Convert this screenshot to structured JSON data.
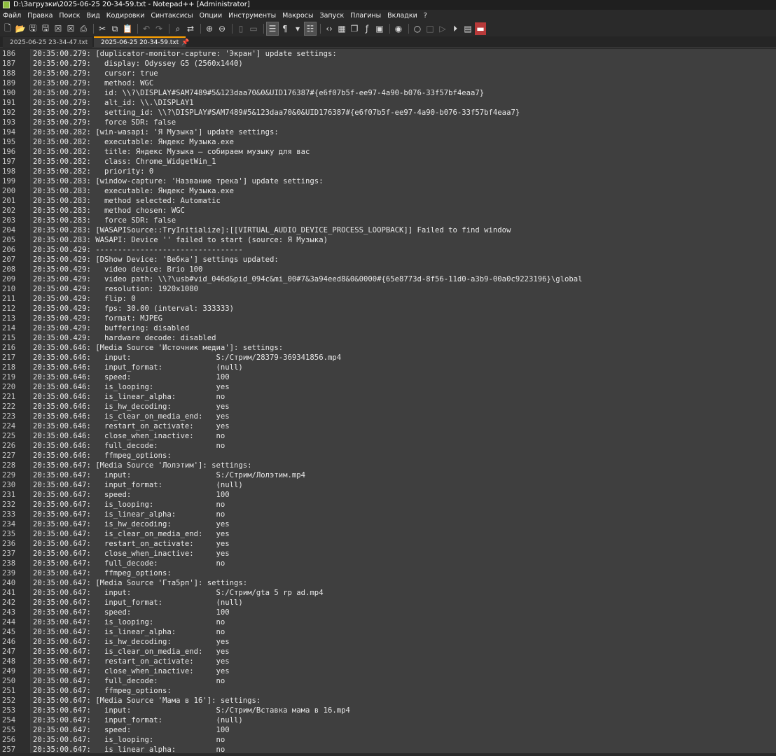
{
  "window": {
    "title": "D:\\Загрузки\\2025-06-25 20-34-59.txt - Notepad++ [Administrator]"
  },
  "menu": [
    "Файл",
    "Правка",
    "Поиск",
    "Вид",
    "Кодировки",
    "Синтаксисы",
    "Опции",
    "Инструменты",
    "Макросы",
    "Запуск",
    "Плагины",
    "Вкладки",
    "?"
  ],
  "toolbar": {
    "icons": [
      {
        "name": "new-file-icon",
        "glyph": "🗋"
      },
      {
        "name": "open-file-icon",
        "glyph": "📂"
      },
      {
        "name": "save-icon",
        "glyph": "🖫"
      },
      {
        "name": "save-all-icon",
        "glyph": "🖫"
      },
      {
        "name": "close-icon",
        "glyph": "☒"
      },
      {
        "name": "close-all-icon",
        "glyph": "☒"
      },
      {
        "name": "print-icon",
        "glyph": "⎙"
      },
      {
        "sep": true
      },
      {
        "name": "cut-icon",
        "glyph": "✂"
      },
      {
        "name": "copy-icon",
        "glyph": "⧉"
      },
      {
        "name": "paste-icon",
        "glyph": "📋"
      },
      {
        "sep": true
      },
      {
        "name": "undo-icon",
        "glyph": "↶",
        "dim": true
      },
      {
        "name": "redo-icon",
        "glyph": "↷",
        "dim": true
      },
      {
        "sep": true
      },
      {
        "name": "find-icon",
        "glyph": "⌕"
      },
      {
        "name": "replace-icon",
        "glyph": "⇄"
      },
      {
        "sep": true
      },
      {
        "name": "zoom-in-icon",
        "glyph": "⊕"
      },
      {
        "name": "zoom-out-icon",
        "glyph": "⊖"
      },
      {
        "sep": true
      },
      {
        "name": "sync-vertical-icon",
        "glyph": "▯",
        "dim": true
      },
      {
        "name": "sync-horizontal-icon",
        "glyph": "▭",
        "dim": true
      },
      {
        "sep": true
      },
      {
        "name": "word-wrap-icon",
        "glyph": "☰",
        "sel": true
      },
      {
        "name": "show-all-chars-icon",
        "glyph": "¶"
      },
      {
        "name": "dropdown-arrow-icon",
        "glyph": "▾"
      },
      {
        "name": "indent-guide-icon",
        "glyph": "☷",
        "sel": true
      },
      {
        "sep": true
      },
      {
        "name": "language-icon",
        "glyph": "‹›"
      },
      {
        "name": "document-map-icon",
        "glyph": "▦"
      },
      {
        "name": "document-list-icon",
        "glyph": "❐"
      },
      {
        "name": "function-list-icon",
        "glyph": "ƒ"
      },
      {
        "name": "folder-workspace-icon",
        "glyph": "▣"
      },
      {
        "sep": true
      },
      {
        "name": "monitoring-icon",
        "glyph": "◉"
      },
      {
        "sep": true
      },
      {
        "name": "record-macro-icon",
        "glyph": "○"
      },
      {
        "name": "stop-macro-icon",
        "glyph": "□",
        "dim": true
      },
      {
        "name": "play-macro-icon",
        "glyph": "▷",
        "dim": true
      },
      {
        "name": "run-macro-multiple-icon",
        "glyph": "⏵"
      },
      {
        "name": "save-macro-icon",
        "glyph": "▤"
      },
      {
        "name": "spell-check-icon",
        "glyph": "▬",
        "danger": true
      }
    ]
  },
  "tabs": [
    {
      "label": "2025-06-25 23-34-47.txt",
      "active": false
    },
    {
      "label": "2025-06-25 20-34-59.txt",
      "active": true
    }
  ],
  "editor": {
    "lines": [
      {
        "n": "186",
        "text": "20:35:00.279: [duplicator-monitor-capture: 'Экран'] update settings:"
      },
      {
        "n": "187",
        "text": "20:35:00.279:   display: Odyssey G5 (2560x1440)"
      },
      {
        "n": "188",
        "text": "20:35:00.279:   cursor: true"
      },
      {
        "n": "189",
        "text": "20:35:00.279:   method: WGC"
      },
      {
        "n": "190",
        "text": "20:35:00.279:   id: \\\\?\\DISPLAY#SAM7489#5&123daa70&0&UID176387#{e6f07b5f-ee97-4a90-b076-33f57bf4eaa7}"
      },
      {
        "n": "191",
        "text": "20:35:00.279:   alt_id: \\\\.\\DISPLAY1"
      },
      {
        "n": "192",
        "text": "20:35:00.279:   setting_id: \\\\?\\DISPLAY#SAM7489#5&123daa70&0&UID176387#{e6f07b5f-ee97-4a90-b076-33f57bf4eaa7}"
      },
      {
        "n": "193",
        "text": "20:35:00.279:   force SDR: false"
      },
      {
        "n": "194",
        "text": "20:35:00.282: [win-wasapi: 'Я Музыка'] update settings:"
      },
      {
        "n": "195",
        "text": "20:35:00.282:   executable: Яндекс Музыка.exe"
      },
      {
        "n": "196",
        "text": "20:35:00.282:   title: Яндекс Музыка — собираем музыку для вас"
      },
      {
        "n": "197",
        "text": "20:35:00.282:   class: Chrome_WidgetWin_1"
      },
      {
        "n": "198",
        "text": "20:35:00.282:   priority: 0"
      },
      {
        "n": "199",
        "text": "20:35:00.283: [window-capture: 'Название трека'] update settings:"
      },
      {
        "n": "200",
        "text": "20:35:00.283:   executable: Яндекс Музыка.exe"
      },
      {
        "n": "201",
        "text": "20:35:00.283:   method selected: Automatic"
      },
      {
        "n": "202",
        "text": "20:35:00.283:   method chosen: WGC"
      },
      {
        "n": "203",
        "text": "20:35:00.283:   force SDR: false"
      },
      {
        "n": "204",
        "text": "20:35:00.283: [WASAPISource::TryInitialize]:[[VIRTUAL_AUDIO_DEVICE_PROCESS_LOOPBACK]] Failed to find window"
      },
      {
        "n": "205",
        "text": "20:35:00.283: WASAPI: Device '' failed to start (source: Я Музыка)"
      },
      {
        "n": "206",
        "text": "20:35:00.429: ---------------------------------"
      },
      {
        "n": "207",
        "text": "20:35:00.429: [DShow Device: 'Вебка'] settings updated:"
      },
      {
        "n": "208",
        "text": "20:35:00.429:   video device: Brio 100"
      },
      {
        "n": "209",
        "text": "20:35:00.429:   video path: \\\\?\\usb#vid_046d&pid_094c&mi_00#7&3a94eed8&0&0000#{65e8773d-8f56-11d0-a3b9-00a0c9223196}\\global"
      },
      {
        "n": "210",
        "text": "20:35:00.429:   resolution: 1920x1080"
      },
      {
        "n": "211",
        "text": "20:35:00.429:   flip: 0"
      },
      {
        "n": "212",
        "text": "20:35:00.429:   fps: 30.00 (interval: 333333)"
      },
      {
        "n": "213",
        "text": "20:35:00.429:   format: MJPEG"
      },
      {
        "n": "214",
        "text": "20:35:00.429:   buffering: disabled"
      },
      {
        "n": "215",
        "text": "20:35:00.429:   hardware decode: disabled"
      },
      {
        "n": "216",
        "text": "20:35:00.646: [Media Source 'Источник медиа']: settings:"
      },
      {
        "n": "217",
        "text": "20:35:00.646:   input:                   S:/Стрим/28379-369341856.mp4"
      },
      {
        "n": "218",
        "text": "20:35:00.646:   input_format:            (null)"
      },
      {
        "n": "219",
        "text": "20:35:00.646:   speed:                   100"
      },
      {
        "n": "220",
        "text": "20:35:00.646:   is_looping:              yes"
      },
      {
        "n": "221",
        "text": "20:35:00.646:   is_linear_alpha:         no"
      },
      {
        "n": "222",
        "text": "20:35:00.646:   is_hw_decoding:          yes"
      },
      {
        "n": "223",
        "text": "20:35:00.646:   is_clear_on_media_end:   yes"
      },
      {
        "n": "224",
        "text": "20:35:00.646:   restart_on_activate:     yes"
      },
      {
        "n": "225",
        "text": "20:35:00.646:   close_when_inactive:     no"
      },
      {
        "n": "226",
        "text": "20:35:00.646:   full_decode:             no"
      },
      {
        "n": "227",
        "text": "20:35:00.646:   ffmpeg_options:"
      },
      {
        "n": "228",
        "text": "20:35:00.647: [Media Source 'Лолэтим']: settings:"
      },
      {
        "n": "229",
        "text": "20:35:00.647:   input:                   S:/Стрим/Лолэтим.mp4"
      },
      {
        "n": "230",
        "text": "20:35:00.647:   input_format:            (null)"
      },
      {
        "n": "231",
        "text": "20:35:00.647:   speed:                   100"
      },
      {
        "n": "232",
        "text": "20:35:00.647:   is_looping:              no"
      },
      {
        "n": "233",
        "text": "20:35:00.647:   is_linear_alpha:         no"
      },
      {
        "n": "234",
        "text": "20:35:00.647:   is_hw_decoding:          yes"
      },
      {
        "n": "235",
        "text": "20:35:00.647:   is_clear_on_media_end:   yes"
      },
      {
        "n": "236",
        "text": "20:35:00.647:   restart_on_activate:     yes"
      },
      {
        "n": "237",
        "text": "20:35:00.647:   close_when_inactive:     yes"
      },
      {
        "n": "238",
        "text": "20:35:00.647:   full_decode:             no"
      },
      {
        "n": "239",
        "text": "20:35:00.647:   ffmpeg_options:"
      },
      {
        "n": "240",
        "text": "20:35:00.647: [Media Source 'Гта5рп']: settings:"
      },
      {
        "n": "241",
        "text": "20:35:00.647:   input:                   S:/Стрим/gta 5 rp ad.mp4"
      },
      {
        "n": "242",
        "text": "20:35:00.647:   input_format:            (null)"
      },
      {
        "n": "243",
        "text": "20:35:00.647:   speed:                   100"
      },
      {
        "n": "244",
        "text": "20:35:00.647:   is_looping:              no"
      },
      {
        "n": "245",
        "text": "20:35:00.647:   is_linear_alpha:         no"
      },
      {
        "n": "246",
        "text": "20:35:00.647:   is_hw_decoding:          yes"
      },
      {
        "n": "247",
        "text": "20:35:00.647:   is_clear_on_media_end:   yes"
      },
      {
        "n": "248",
        "text": "20:35:00.647:   restart_on_activate:     yes"
      },
      {
        "n": "249",
        "text": "20:35:00.647:   close_when_inactive:     yes"
      },
      {
        "n": "250",
        "text": "20:35:00.647:   full_decode:             no"
      },
      {
        "n": "251",
        "text": "20:35:00.647:   ffmpeg_options:"
      },
      {
        "n": "252",
        "text": "20:35:00.647: [Media Source 'Мама в 16']: settings:"
      },
      {
        "n": "253",
        "text": "20:35:00.647:   input:                   S:/Стрим/Вставка мама в 16.mp4"
      },
      {
        "n": "254",
        "text": "20:35:00.647:   input_format:            (null)"
      },
      {
        "n": "255",
        "text": "20:35:00.647:   speed:                   100"
      },
      {
        "n": "256",
        "text": "20:35:00.647:   is_looping:              no"
      },
      {
        "n": "257",
        "text": "20:35:00.647:   is_linear_alpha:         no"
      }
    ]
  }
}
